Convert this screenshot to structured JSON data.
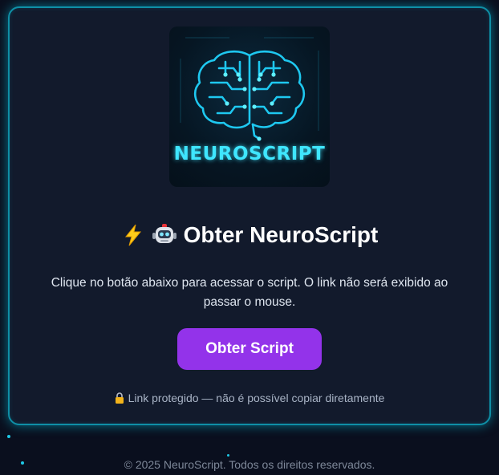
{
  "logo": {
    "text": "NEUROSCRIPT",
    "icon": "brain-circuit-icon"
  },
  "title": {
    "icons": [
      "lightning-icon",
      "robot-icon"
    ],
    "text": "Obter NeuroScript"
  },
  "description": "Clique no botão abaixo para acessar o script. O link não será exibido ao passar o mouse.",
  "button": {
    "label": "Obter Script"
  },
  "note": {
    "icon": "lock-icon",
    "text": "Link protegido — não é possível copiar diretamente"
  },
  "footer": "© 2025 NeuroScript. Todos os direitos reservados.",
  "colors": {
    "accent": "#9333ea",
    "glow": "#0f8fa6",
    "logo_text": "#3fe6ff",
    "background": "#0a0f1e",
    "card": "#121a2c"
  }
}
